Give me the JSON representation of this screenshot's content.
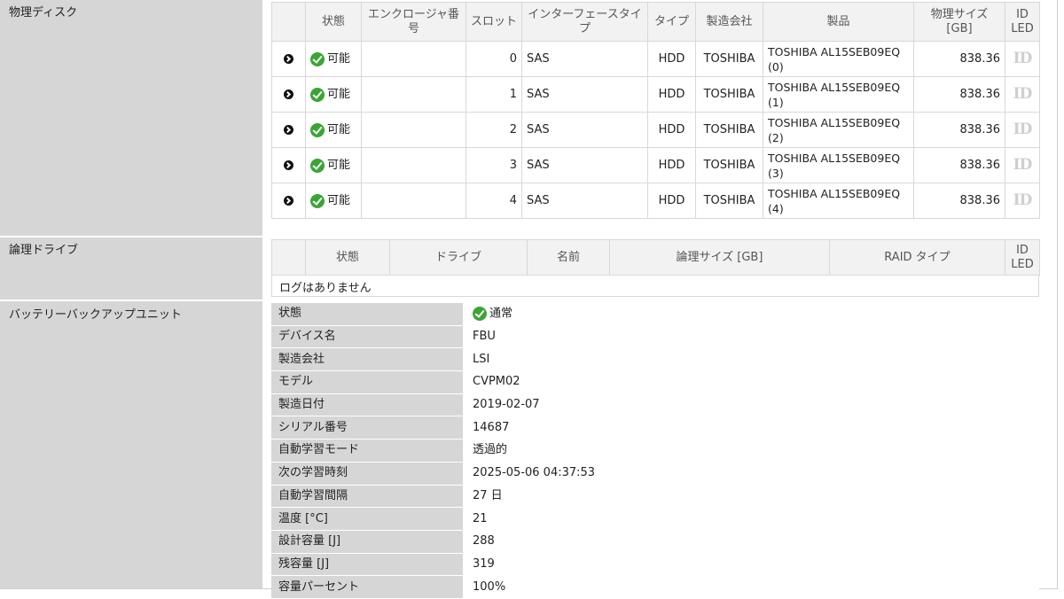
{
  "physical_disks": {
    "label": "物理ディスク",
    "headers": {
      "status": "状態",
      "enclosure": "エンクロージャ番号",
      "slot": "スロット",
      "interface": "インターフェースタイプ",
      "type": "タイプ",
      "maker": "製造会社",
      "product": "製品",
      "size": "物理サイズ [GB]",
      "idled": "ID LED"
    },
    "rows": [
      {
        "status": "可能",
        "enclosure": "",
        "slot": "0",
        "interface": "SAS",
        "type": "HDD",
        "maker": "TOSHIBA",
        "product": "TOSHIBA AL15SEB09EQ (0)",
        "size": "838.36",
        "idled": "ID"
      },
      {
        "status": "可能",
        "enclosure": "",
        "slot": "1",
        "interface": "SAS",
        "type": "HDD",
        "maker": "TOSHIBA",
        "product": "TOSHIBA AL15SEB09EQ (1)",
        "size": "838.36",
        "idled": "ID"
      },
      {
        "status": "可能",
        "enclosure": "",
        "slot": "2",
        "interface": "SAS",
        "type": "HDD",
        "maker": "TOSHIBA",
        "product": "TOSHIBA AL15SEB09EQ (2)",
        "size": "838.36",
        "idled": "ID"
      },
      {
        "status": "可能",
        "enclosure": "",
        "slot": "3",
        "interface": "SAS",
        "type": "HDD",
        "maker": "TOSHIBA",
        "product": "TOSHIBA AL15SEB09EQ (3)",
        "size": "838.36",
        "idled": "ID"
      },
      {
        "status": "可能",
        "enclosure": "",
        "slot": "4",
        "interface": "SAS",
        "type": "HDD",
        "maker": "TOSHIBA",
        "product": "TOSHIBA AL15SEB09EQ (4)",
        "size": "838.36",
        "idled": "ID"
      }
    ]
  },
  "logical_drives": {
    "label": "論理ドライブ",
    "headers": {
      "status": "状態",
      "drive": "ドライブ",
      "name": "名前",
      "size": "論理サイズ [GB]",
      "raid": "RAID タイプ",
      "idled": "ID LED"
    },
    "empty_message": "ログはありません"
  },
  "bbu": {
    "label": "バッテリーバックアップユニット",
    "fields": [
      {
        "key": "状態",
        "value": "通常",
        "icon": "ok"
      },
      {
        "key": "デバイス名",
        "value": "FBU"
      },
      {
        "key": "製造会社",
        "value": "LSI"
      },
      {
        "key": "モデル",
        "value": "CVPM02"
      },
      {
        "key": "製造日付",
        "value": "2019-02-07"
      },
      {
        "key": "シリアル番号",
        "value": "14687"
      },
      {
        "key": "自動学習モード",
        "value": "透過的"
      },
      {
        "key": "次の学習時刻",
        "value": "2025-05-06 04:37:53"
      },
      {
        "key": "自動学習間隔",
        "value": "27 日"
      },
      {
        "key": "温度 [°C]",
        "value": "21"
      },
      {
        "key": "設計容量 [J]",
        "value": "288"
      },
      {
        "key": "残容量 [J]",
        "value": "319"
      },
      {
        "key": "容量パーセント",
        "value": "100%"
      }
    ]
  },
  "colors": {
    "label_bg": "#d6d6d6",
    "header_bg": "#f2f2f2",
    "ok_green": "#3aa535",
    "id_led_gray": "#cfcfcf"
  }
}
